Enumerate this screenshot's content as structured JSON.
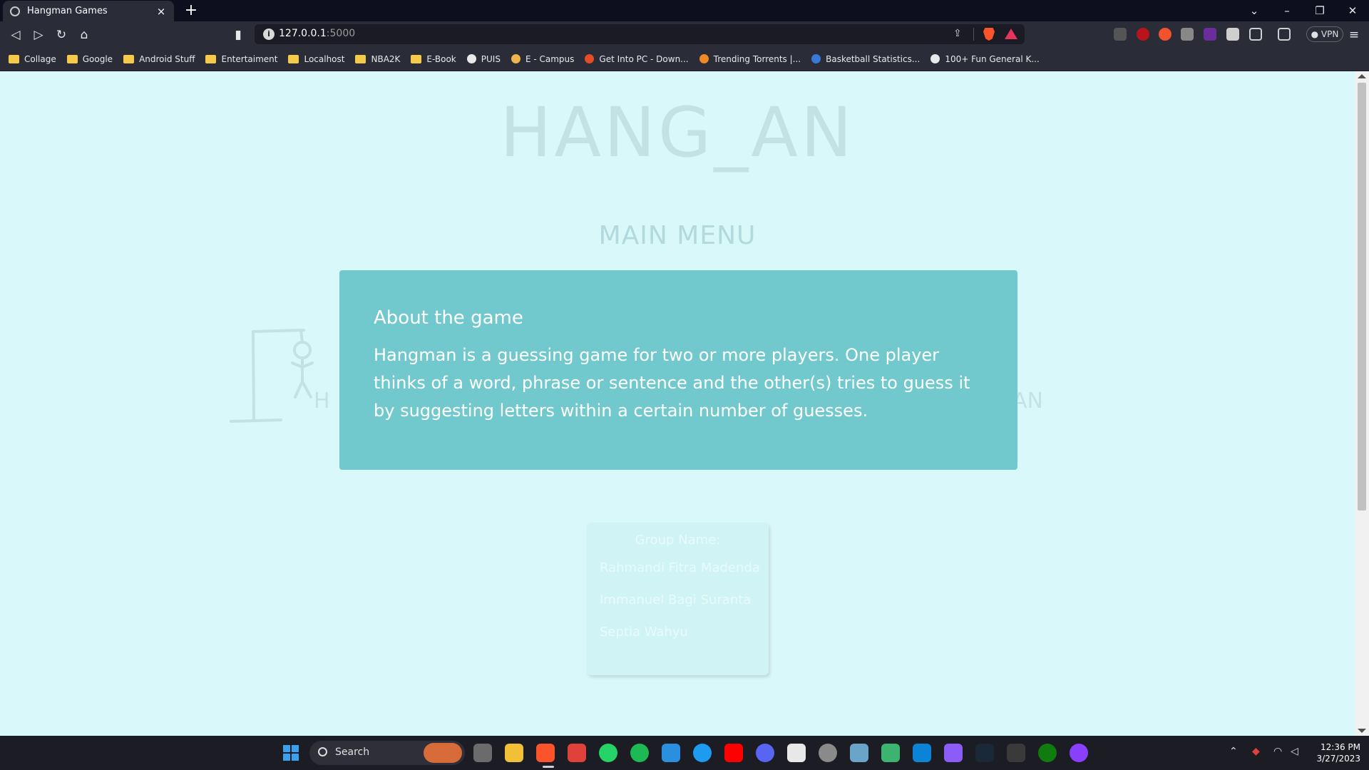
{
  "browser": {
    "tab_title": "Hangman Games",
    "tab_close": "×",
    "new_tab": "+",
    "url_host": "127.0.0.1",
    "url_port": ":5000",
    "vpn_label": "● VPN",
    "bookmarks": [
      {
        "label": "Collage",
        "icon": "folder"
      },
      {
        "label": "Google",
        "icon": "folder"
      },
      {
        "label": "Android Stuff",
        "icon": "folder"
      },
      {
        "label": "Entertaiment",
        "icon": "folder"
      },
      {
        "label": "Localhost",
        "icon": "folder"
      },
      {
        "label": "NBA2K",
        "icon": "folder"
      },
      {
        "label": "E-Book",
        "icon": "folder"
      },
      {
        "label": "PUIS",
        "icon": "site"
      },
      {
        "label": "E - Campus",
        "icon": "site"
      },
      {
        "label": "Get Into PC - Down...",
        "icon": "site"
      },
      {
        "label": "Trending Torrents |...",
        "icon": "site"
      },
      {
        "label": "Basketball Statistics...",
        "icon": "site"
      },
      {
        "label": "100+ Fun General K...",
        "icon": "site"
      }
    ]
  },
  "page": {
    "game_title": "HANG_AN",
    "menu_title": "MAIN MENU",
    "left_letter": "H",
    "right_letters": "AN",
    "about": {
      "heading": "About the game",
      "body": "Hangman is a guessing game for two or more players. One player thinks of a word, phrase or sentence and the other(s) tries to guess it by suggesting letters within a certain number of guesses."
    },
    "group": {
      "heading": "Group Name:",
      "members": [
        "Rahmandi Fitra Madenda",
        "Immanuel Bagi Suranta",
        "Septia Wahyu"
      ]
    }
  },
  "taskbar": {
    "search_label": "Search",
    "clock_time": "12:36 PM",
    "clock_date": "3/27/2023"
  },
  "colors": {
    "page_bg": "#d9f8fa",
    "card_bg": "#72c9cd",
    "chrome_bg": "#2a2c37"
  }
}
